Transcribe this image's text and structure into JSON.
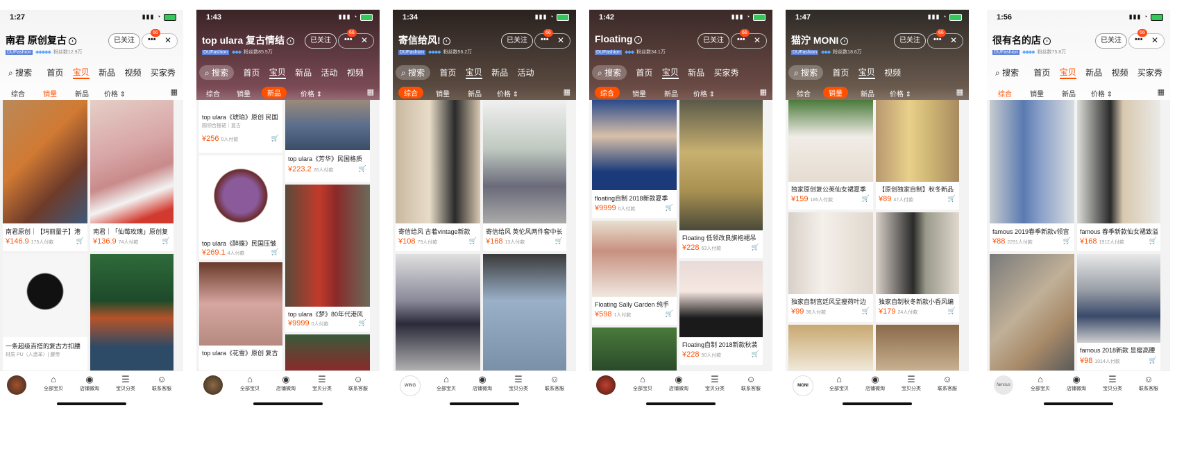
{
  "shared": {
    "follow_label": "已关注",
    "more_label": "•••",
    "close_label": "✕",
    "badge_label": "66",
    "tag_label": "DUFashion",
    "sort": [
      "综合",
      "销量",
      "新品",
      "价格 ⇕"
    ],
    "bottom": [
      "全部宝贝",
      "店铺微淘",
      "宝贝分类",
      "联系客服"
    ],
    "bottom_icons": [
      "bag-icon",
      "broadcast-icon",
      "list-icon",
      "chat-icon"
    ],
    "accent_color": "#ff5000"
  },
  "phones": [
    {
      "time": "1:27",
      "store_name": "南君 原创复古",
      "fans": "粉丝数12.9万",
      "tabs": [
        "搜索",
        "首页",
        "宝贝",
        "新品",
        "视频",
        "买家秀"
      ],
      "active_tab": 2,
      "active_sort": 1,
      "cards": [
        {
          "title": "南君原创｜【玛丽量子】港",
          "price": "¥146.9",
          "sold": "175人付款"
        },
        {
          "title": "南君｜「仙莓玫瑰」原创复",
          "price": "¥136.9",
          "sold": "74人付款"
        },
        {
          "title": "一条超级百搭的复古方扣腰",
          "price": "",
          "sold": "材质 PU（人造革）| 腰带"
        },
        {
          "title": "",
          "price": "",
          "sold": ""
        }
      ]
    },
    {
      "time": "1:43",
      "store_name": "top ulara 复古情结",
      "fans": "粉丝数85.5万",
      "tabs": [
        "搜索",
        "首页",
        "宝贝",
        "新品",
        "活动",
        "视频"
      ],
      "active_tab": 2,
      "active_sort": 2,
      "cards": [
        {
          "title": "top ulara《琥珀》原创 民国",
          "price": "¥256",
          "sold": "0人付款",
          "sub": "圆领合摆裙｜复古"
        },
        {
          "title": "top ulara《芳华》民国格质",
          "price": "¥223.2",
          "sold": "26人付款"
        },
        {
          "title": "top ulara《醉蝶》民国压皱",
          "price": "¥269.1",
          "sold": "4人付款"
        },
        {
          "title": "top ulara《梦》80年代港风",
          "price": "¥9999",
          "sold": "0人付款"
        },
        {
          "title": "top ulara《花雪》原创 复古",
          "price": "",
          "sold": ""
        }
      ]
    },
    {
      "time": "1:34",
      "store_name": "寄信给风!",
      "fans": "粉丝数56.2万",
      "tabs": [
        "搜索",
        "首页",
        "宝贝",
        "新品",
        "活动"
      ],
      "active_tab": 2,
      "active_sort": 0,
      "cards": [
        {
          "title": "寄信给风 古着vintage新款",
          "price": "¥108",
          "sold": "79人付款"
        },
        {
          "title": "寄信给风 英伦风两件套中长",
          "price": "¥168",
          "sold": "13人付款"
        },
        {
          "title": "",
          "price": "",
          "sold": ""
        },
        {
          "title": "",
          "price": "",
          "sold": ""
        }
      ]
    },
    {
      "time": "1:42",
      "store_name": "Floating",
      "fans": "粉丝数34.1万",
      "tabs": [
        "搜索",
        "首页",
        "宝贝",
        "新品",
        "买家秀"
      ],
      "active_tab": 2,
      "active_sort": 0,
      "cards": [
        {
          "title": "floating自制 2018新款夏季",
          "price": "¥9999",
          "sold": "0人付款"
        },
        {
          "title": "Floating 低领改良旗袍裙吊",
          "price": "¥228",
          "sold": "63人付款"
        },
        {
          "title": "Floating Sally Garden 纯手",
          "price": "¥598",
          "sold": "1人付款"
        },
        {
          "title": "Floating自制 2018新款秋装",
          "price": "¥228",
          "sold": "50人付款"
        },
        {
          "title": "",
          "price": "",
          "sold": ""
        }
      ]
    },
    {
      "time": "1:47",
      "store_name": "猫泞 MONI",
      "fans": "粉丝数18.6万",
      "tabs": [
        "搜索",
        "首页",
        "宝贝",
        "视频"
      ],
      "active_tab": 2,
      "active_sort": 1,
      "cards": [
        {
          "title": "独家原创复公英仙女裙夏季",
          "price": "¥159",
          "sold": "185人付款"
        },
        {
          "title": "【原创独家自制】秋冬新品",
          "price": "¥89",
          "sold": "47人付款"
        },
        {
          "title": "独家自制宫廷风显瘦荷叶边",
          "price": "¥99",
          "sold": "36人付款"
        },
        {
          "title": "独家自制秋冬新款小香风编",
          "price": "¥179",
          "sold": "24人付款"
        },
        {
          "title": "",
          "price": "",
          "sold": ""
        },
        {
          "title": "",
          "price": "",
          "sold": ""
        }
      ]
    },
    {
      "time": "1:56",
      "store_name": "很有名的店",
      "fans": "粉丝数75.8万",
      "tabs": [
        "搜索",
        "首页",
        "宝贝",
        "新品",
        "视频",
        "买家秀"
      ],
      "active_tab": 2,
      "active_sort": 0,
      "cards": [
        {
          "title": "famous 2019春季新款v领宫",
          "price": "¥88",
          "sold": "2291人付款"
        },
        {
          "title": "famous 春季新款仙女裙致溢",
          "price": "¥168",
          "sold": "1912人付款"
        },
        {
          "title": "",
          "price": "",
          "sold": ""
        },
        {
          "title": "famous 2018新款 显瘦高腰",
          "price": "¥98",
          "sold": "1014人付款"
        }
      ]
    }
  ]
}
